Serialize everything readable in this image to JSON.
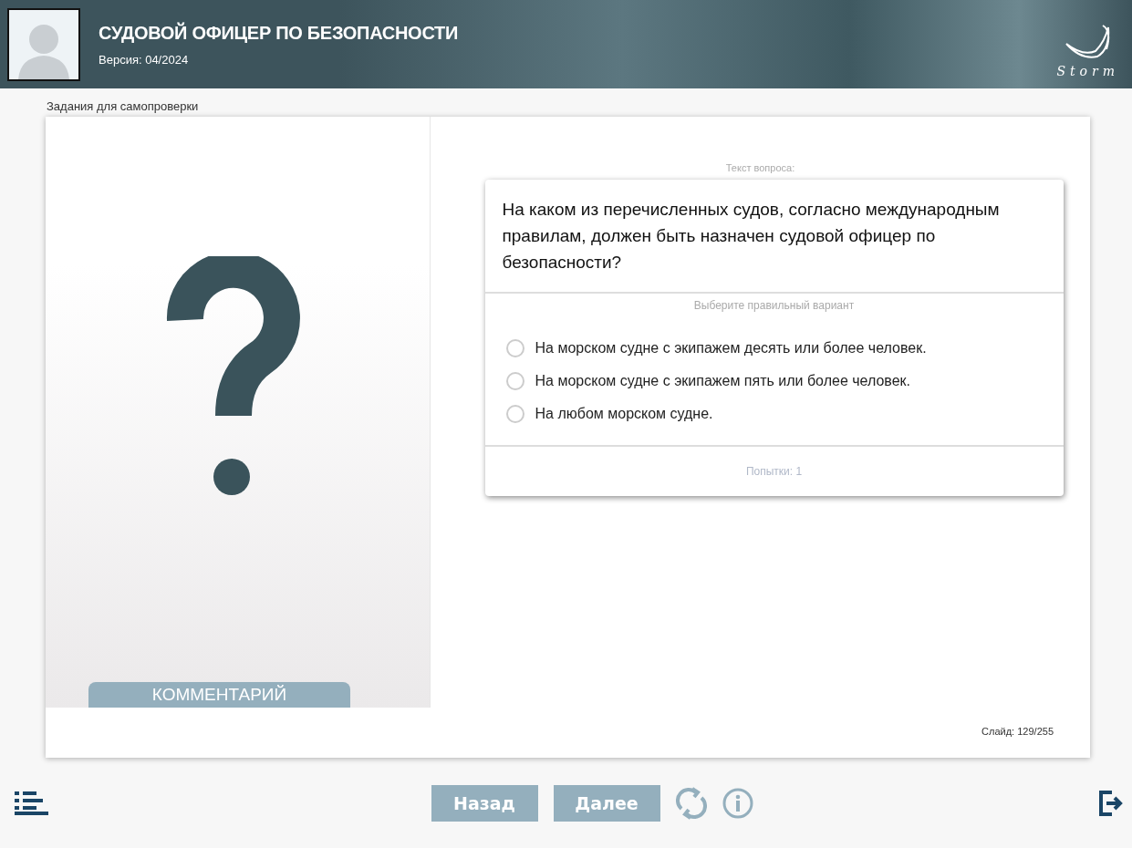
{
  "header": {
    "title": "СУДОВОЙ ОФИЦЕР ПО БЕЗОПАСНОСТИ",
    "version": "Версия: 04/2024",
    "logo_text": "Storm"
  },
  "section_title": "Задания для самопроверки",
  "comment_tab": "КОММЕНТАРИЙ",
  "question": {
    "caption": "Текст вопроса:",
    "text": "На каком из перечисленных судов, согласно международным правилам, должен быть назначен судовой офицер по безопасности?",
    "hint": "Выберите правильный вариант",
    "options": [
      {
        "label": "На морском судне с экипажем десять или более человек.",
        "selected": false
      },
      {
        "label": "На морском судне с экипажем пять или более человек.",
        "selected": false
      },
      {
        "label": "На любом морском судне.",
        "selected": false
      }
    ],
    "attempts": "Попытки: 1"
  },
  "slide_counter": "Слайд: 129/255",
  "buttons": [
    {
      "label": "Назад",
      "disabled": false
    },
    {
      "label": "Далее",
      "disabled": false
    }
  ]
}
